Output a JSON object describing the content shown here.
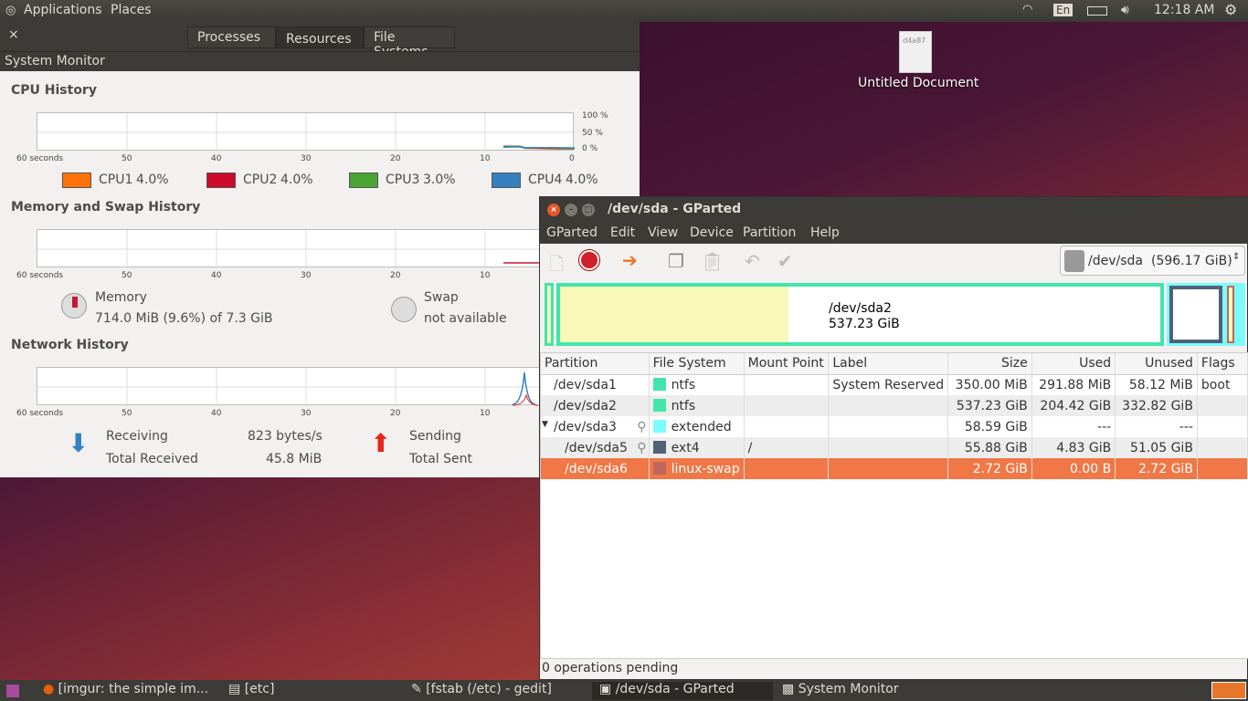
{
  "top_panel": {
    "applications": "Applications",
    "places": "Places",
    "keyboard": "En",
    "clock": "12:18 AM",
    "icons": [
      "wifi-icon",
      "battery-icon",
      "volume-icon",
      "power-gear-icon"
    ]
  },
  "desktop": {
    "icon_label": "Untitled Document",
    "icon_text": "d4a87"
  },
  "system_monitor": {
    "title": "System Monitor",
    "close": "×",
    "tabs": [
      {
        "label": "Processes"
      },
      {
        "label": "Resources",
        "active": true
      },
      {
        "label": "File Systems"
      }
    ],
    "cpu": {
      "heading": "CPU History",
      "y_ticks": [
        "100 %",
        "50 %",
        "0 %"
      ],
      "x_ticks": [
        "60 seconds",
        "50",
        "40",
        "30",
        "20",
        "10",
        "0"
      ],
      "legend": [
        {
          "label": "CPU1",
          "value": "4.0%",
          "color": "#ff7208"
        },
        {
          "label": "CPU2",
          "value": "4.0%",
          "color": "#cc0a2a"
        },
        {
          "label": "CPU3",
          "value": "3.0%",
          "color": "#4aa332"
        },
        {
          "label": "CPU4",
          "value": "4.0%",
          "color": "#3580bf"
        }
      ]
    },
    "memory": {
      "heading": "Memory and Swap History",
      "x_ticks": [
        "60 seconds",
        "50",
        "40",
        "30",
        "20",
        "10"
      ],
      "memory_label": "Memory",
      "memory_value": "714.0 MiB (9.6%) of 7.3 GiB",
      "swap_label": "Swap",
      "swap_value": "not available"
    },
    "network": {
      "heading": "Network History",
      "x_ticks": [
        "60 seconds",
        "50",
        "40",
        "30",
        "20",
        "10"
      ],
      "receiving_label": "Receiving",
      "receiving_value": "823 bytes/s",
      "total_received_label": "Total Received",
      "total_received_value": "45.8 MiB",
      "sending_label": "Sending",
      "total_sent_label": "Total Sent"
    }
  },
  "gparted": {
    "title": "/dev/sda - GParted",
    "menu": [
      "GParted",
      "Edit",
      "View",
      "Device",
      "Partition",
      "Help"
    ],
    "device": "/dev/sda",
    "device_size": "(596.17 GiB)",
    "disk_map": {
      "label": "/dev/sda2",
      "size": "537.23 GiB"
    },
    "columns": [
      "Partition",
      "File System",
      "Mount Point",
      "Label",
      "Size",
      "Used",
      "Unused",
      "Flags"
    ],
    "rows": [
      {
        "partition": "/dev/sda1",
        "fs": "ntfs",
        "fs_color": "#42e5ac",
        "mount": "",
        "label": "System Reserved",
        "size": "350.00 MiB",
        "used": "291.88 MiB",
        "unused": "58.12 MiB",
        "flags": "boot"
      },
      {
        "partition": "/dev/sda2",
        "fs": "ntfs",
        "fs_color": "#42e5ac",
        "mount": "",
        "label": "",
        "size": "537.23 GiB",
        "used": "204.42 GiB",
        "unused": "332.82 GiB",
        "flags": ""
      },
      {
        "partition": "/dev/sda3",
        "fs": "extended",
        "fs_color": "#7dfcfe",
        "mount": "",
        "label": "",
        "size": "58.59 GiB",
        "used": "---",
        "unused": "---",
        "flags": "",
        "expander": true,
        "key": true
      },
      {
        "partition": "/dev/sda5",
        "fs": "ext4",
        "fs_color": "#4f6279",
        "mount": "/",
        "label": "",
        "size": "55.88 GiB",
        "used": "4.83 GiB",
        "unused": "51.05 GiB",
        "flags": "",
        "key": true,
        "indent": true
      },
      {
        "partition": "/dev/sda6",
        "fs": "linux-swap",
        "fs_color": "#c1665a",
        "mount": "",
        "label": "",
        "size": "2.72 GiB",
        "used": "0.00 B",
        "unused": "2.72 GiB",
        "flags": "",
        "indent": true,
        "selected": true
      }
    ],
    "status": "0 operations pending"
  },
  "taskbar": [
    {
      "label": "[imgur: the simple im..."
    },
    {
      "label": "[etc]"
    },
    {
      "label": "[fstab (/etc) - gedit]"
    },
    {
      "label": "/dev/sda - GParted",
      "active": true
    },
    {
      "label": "System Monitor"
    }
  ]
}
